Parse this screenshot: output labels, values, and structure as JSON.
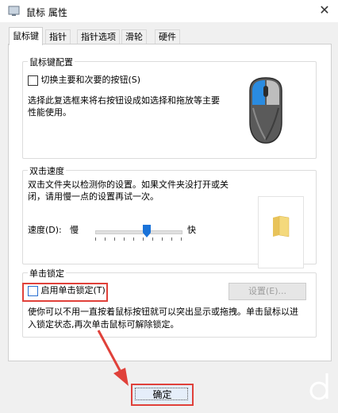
{
  "window": {
    "title": "鼠标 属性",
    "close_glyph": "✕"
  },
  "tabs": [
    {
      "label": "鼠标键",
      "active": true
    },
    {
      "label": "指针"
    },
    {
      "label": "指针选项"
    },
    {
      "label": "滑轮"
    },
    {
      "label": "硬件"
    }
  ],
  "button_config": {
    "group_label": "鼠标键配置",
    "swap_checkbox_label": "切换主要和次要的按钮(S)",
    "description_line1": "选择此复选框来将右按钮设成如选择和拖放等主要",
    "description_line2": "性能使用。"
  },
  "double_click": {
    "group_label": "双击速度",
    "description_line1": "双击文件夹以检测你的设置。如果文件夹没打开或关",
    "description_line2": "闭，请用慢一点的设置再试一次。",
    "speed_label": "速度(D):",
    "slow_label": "慢",
    "fast_label": "快",
    "speed_fraction": 0.6
  },
  "click_lock": {
    "group_label": "单击锁定",
    "checkbox_label": "启用单击锁定(T)",
    "settings_button": "设置(E)...",
    "description_line1": "使你可以不用一直按着鼠标按钮就可以突出显示或拖拽。单击鼠标以进",
    "description_line2": "入锁定状态,再次单击鼠标可解除锁定。"
  },
  "footer": {
    "ok_label": "确定"
  },
  "colors": {
    "highlight": "#e0413a",
    "mouse_accent": "#2a8be0"
  }
}
